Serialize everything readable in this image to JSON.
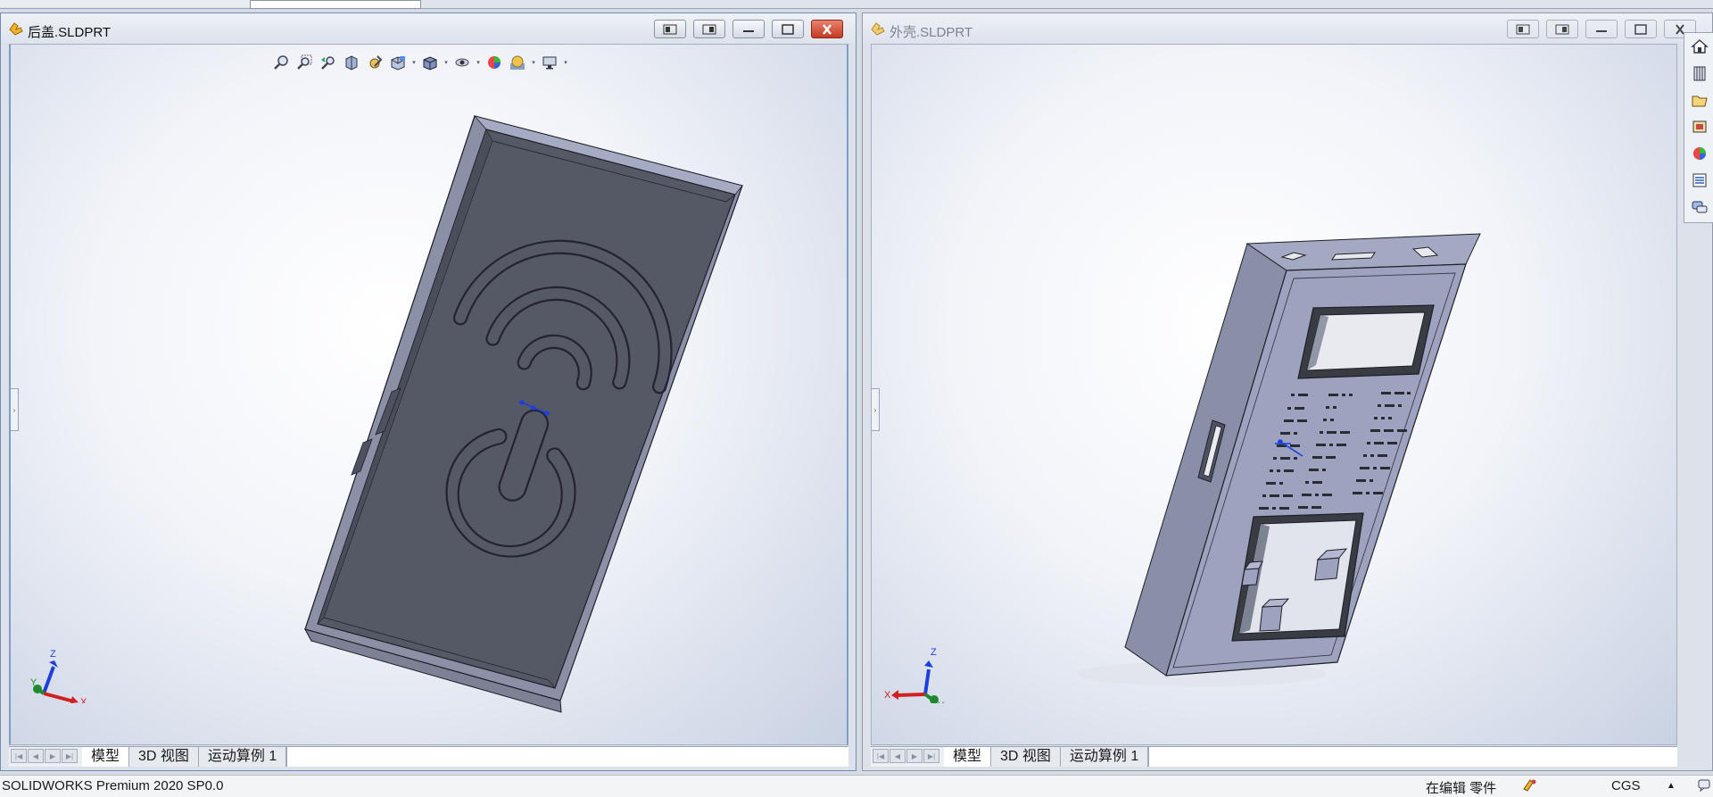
{
  "app": {
    "status": "SOLIDWORKS Premium 2020 SP0.0"
  },
  "windows": [
    {
      "title": "后盖.SLDPRT",
      "active": true,
      "tabs": [
        "模型",
        "3D 视图",
        "运动算例 1"
      ],
      "triad": {
        "x": "X",
        "y": "Y",
        "z": "Z"
      }
    },
    {
      "title": "外壳.SLDPRT",
      "active": false,
      "tabs": [
        "模型",
        "3D 视图",
        "运动算例 1"
      ],
      "triad": {
        "x": "X",
        "y": "Y",
        "z": "Z"
      }
    }
  ],
  "heads_up_toolbar": [
    "zoom-to-fit-icon",
    "zoom-to-area-icon",
    "previous-view-icon",
    "section-view-icon",
    "dynamic-annotation-icon",
    "view-orientation-icon",
    "display-style-icon",
    "hide-show-items-icon",
    "edit-appearance-icon",
    "apply-scene-icon",
    "view-settings-icon"
  ],
  "task_pane": [
    "solidworks-resources-icon",
    "design-library-icon",
    "file-explorer-icon",
    "view-palette-icon",
    "appearances-scenes-icon",
    "custom-properties-icon",
    "forum-icon"
  ],
  "status": {
    "mode": "在编辑 零件",
    "units": "CGS"
  },
  "colors": {
    "titlebar_text": "#111111",
    "inactive_title_text": "#7a8394",
    "close_button": "#c23b22",
    "part_dark": "#585c69",
    "part_light": "#8f94b0",
    "accent": "#1f3fdc"
  }
}
